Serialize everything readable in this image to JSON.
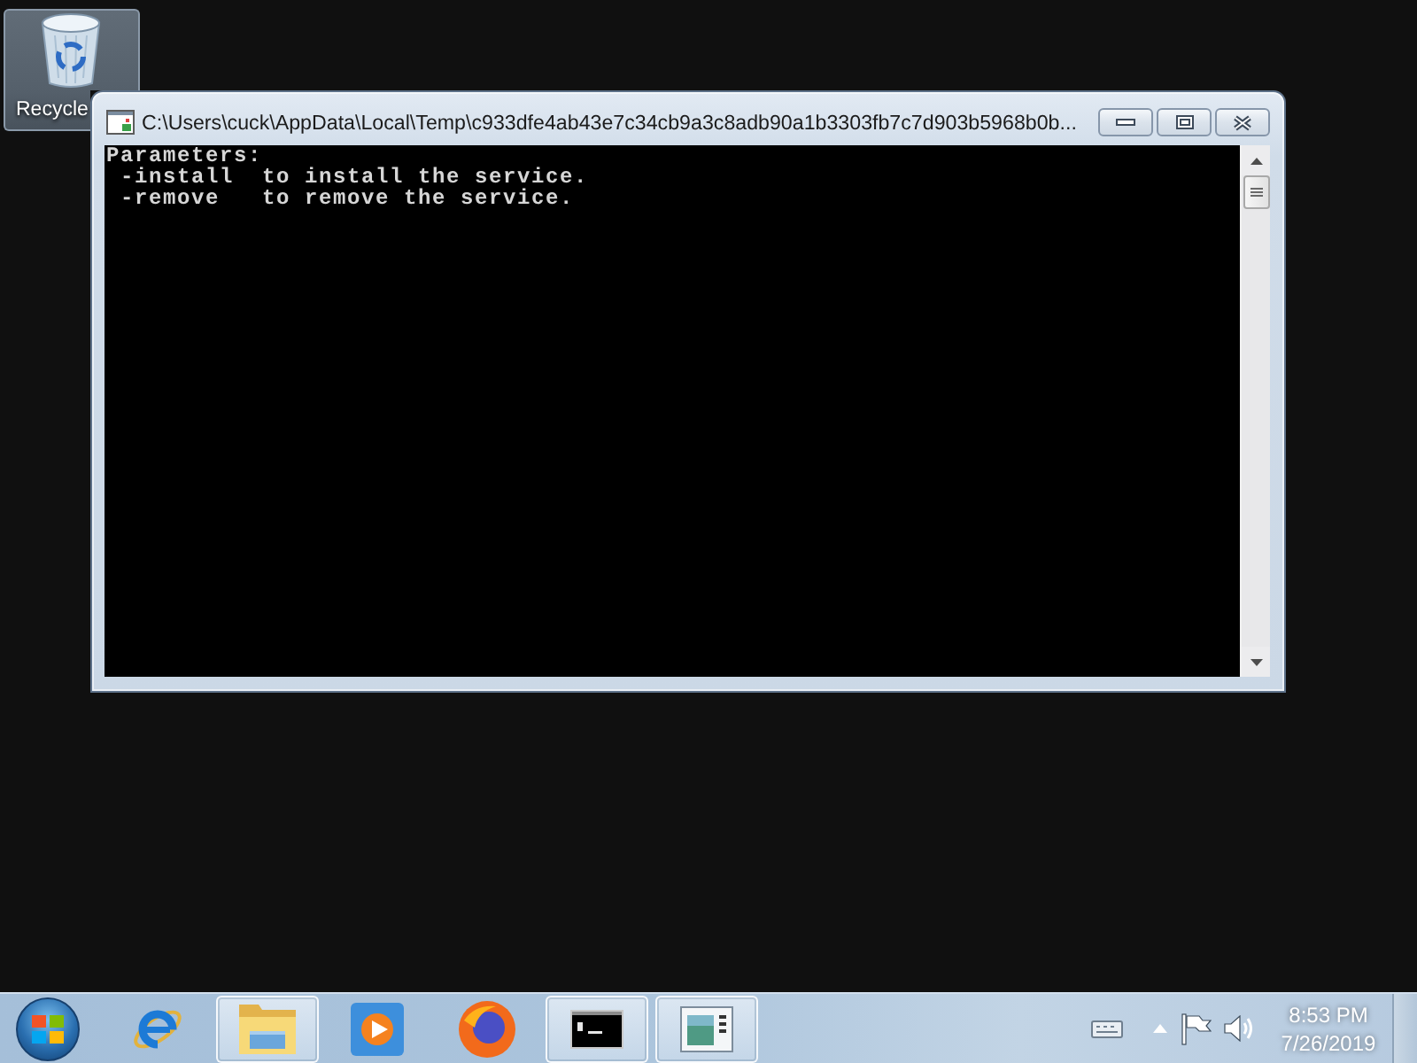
{
  "desktop": {
    "icons": [
      {
        "label": "Recycle",
        "selected": true
      }
    ]
  },
  "window": {
    "title": "C:\\Users\\cuck\\AppData\\Local\\Temp\\c933dfe4ab43e7c34cb9a3c8adb90a1b3303fb7c7d903b5968b0b...",
    "console": {
      "heading": "Parameters:",
      "options": [
        {
          "flag": "-install",
          "description": "to install the service."
        },
        {
          "flag": "-remove",
          "description": "to remove the service."
        }
      ]
    }
  },
  "taskbar": {
    "items": [
      {
        "kind": "ie",
        "running": false
      },
      {
        "kind": "folder",
        "running": true
      },
      {
        "kind": "player",
        "running": false
      },
      {
        "kind": "firefox",
        "running": false
      },
      {
        "kind": "console",
        "running": true
      },
      {
        "kind": "document",
        "running": true
      }
    ],
    "clock": {
      "time": "8:53 PM",
      "date": "7/26/2019"
    }
  }
}
